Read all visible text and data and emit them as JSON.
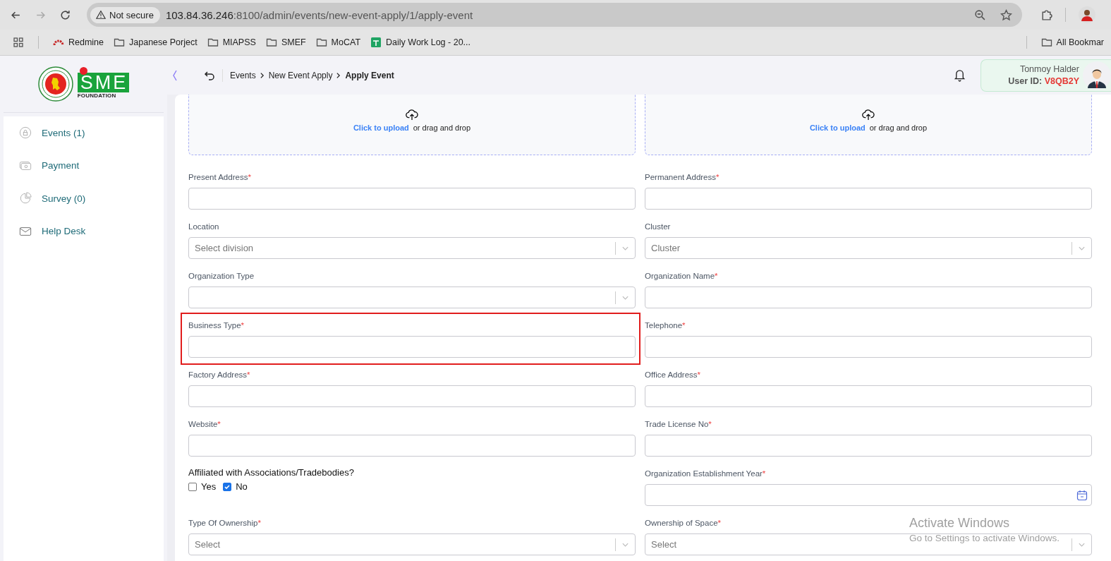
{
  "browser": {
    "not_secure": "Not secure",
    "url_host": "103.84.36.246",
    "url_rest": ":8100/admin/events/new-event-apply/1/apply-event",
    "bookmarks": [
      {
        "label": "Redmine",
        "kind": "redmine"
      },
      {
        "label": "Japanese Porject",
        "kind": "folder"
      },
      {
        "label": "MIAPSS",
        "kind": "folder"
      },
      {
        "label": "SMEF",
        "kind": "folder"
      },
      {
        "label": "MoCAT",
        "kind": "folder"
      },
      {
        "label": "Daily Work Log - 20...",
        "kind": "sheet"
      }
    ],
    "all_bookmarks": "All Bookmar"
  },
  "logo": {
    "text": "SME",
    "subtitle": "FOUNDATION"
  },
  "sidebar": {
    "items": [
      {
        "label": "Events (1)",
        "kind": "lock"
      },
      {
        "label": "Payment",
        "kind": "money"
      },
      {
        "label": "Survey (0)",
        "kind": "pie"
      },
      {
        "label": "Help Desk",
        "kind": "mail"
      }
    ]
  },
  "breadcrumb": [
    {
      "label": "Events",
      "current": false
    },
    {
      "label": "New Event Apply",
      "current": false
    },
    {
      "label": "Apply Event",
      "current": true
    }
  ],
  "user": {
    "name": "Tonmoy Halder",
    "id_label": "User ID:",
    "id": "V8QB2Y"
  },
  "uploads": [
    {
      "link": "Click to upload",
      "rest": "or drag and drop"
    },
    {
      "link": "Click to upload",
      "rest": "or drag and drop"
    }
  ],
  "fields": [
    {
      "kind": "text",
      "label": "Present Address",
      "required_mark": "*",
      "highlighted": false
    },
    {
      "kind": "text",
      "label": "Permanent Address",
      "required_mark": "*",
      "highlighted": false
    },
    {
      "kind": "select",
      "label": "Location",
      "placeholder": "Select division",
      "highlighted": false
    },
    {
      "kind": "select",
      "label": "Cluster",
      "placeholder": "Cluster",
      "highlighted": false
    },
    {
      "kind": "select",
      "label": "Organization Type",
      "highlighted": false
    },
    {
      "kind": "text",
      "label": "Organization Name",
      "required_mark": "*",
      "highlighted": false
    },
    {
      "kind": "text",
      "label": "Business Type",
      "required_mark": "*",
      "highlighted": true
    },
    {
      "kind": "text",
      "label": "Telephone",
      "required_mark": "*",
      "highlighted": false
    },
    {
      "kind": "text",
      "label": "Factory Address",
      "required_mark": "*",
      "highlighted": false
    },
    {
      "kind": "text",
      "label": "Office Address",
      "required_mark": "*",
      "highlighted": false
    },
    {
      "kind": "text",
      "label": "Website",
      "required_mark": "*",
      "highlighted": false
    },
    {
      "kind": "text",
      "label": "Trade License No",
      "required_mark": "*",
      "highlighted": false
    },
    {
      "kind": "checks",
      "label": "Affiliated with Associations/Tradebodies?",
      "highlighted": false,
      "options": [
        {
          "label": "Yes",
          "checked": false
        },
        {
          "label": "No",
          "checked": true
        }
      ]
    },
    {
      "kind": "date",
      "label": "Organization Establishment Year",
      "required_mark": "*",
      "highlighted": false
    },
    {
      "kind": "select",
      "label": "Type Of Ownership",
      "required_mark": "*",
      "placeholder": "Select",
      "highlighted": false
    },
    {
      "kind": "select",
      "label": "Ownership of Space",
      "required_mark": "*",
      "placeholder": "Select",
      "highlighted": false
    }
  ],
  "os_notice": {
    "title": "Activate Windows",
    "subtitle": "Go to Settings to activate Windows."
  }
}
